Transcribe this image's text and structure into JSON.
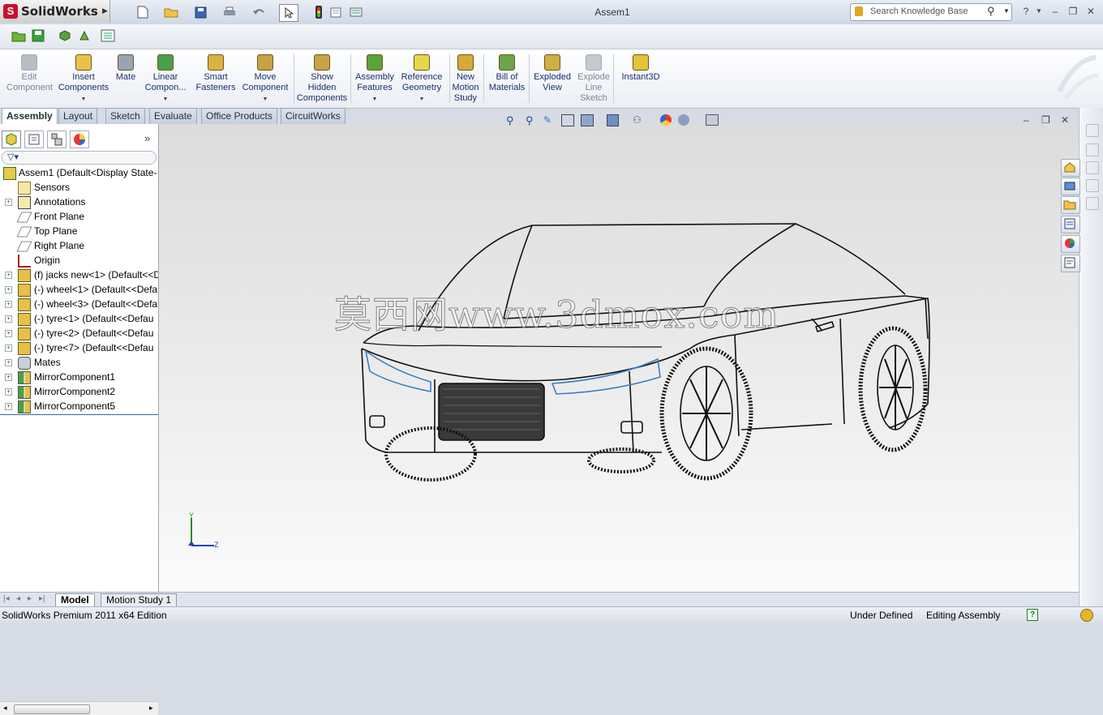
{
  "app": {
    "logo_text": "SolidWorks",
    "document_title": "Assem1"
  },
  "search": {
    "placeholder": "Search Knowledge Base"
  },
  "command_manager": [
    {
      "label_lines": [
        "Edit",
        "Component"
      ],
      "disabled": true,
      "icon": "edit-component-icon",
      "dropdown": false
    },
    {
      "label_lines": [
        "Insert",
        "Components"
      ],
      "disabled": false,
      "icon": "insert-components-icon",
      "dropdown": true
    },
    {
      "label_lines": [
        "Mate"
      ],
      "disabled": false,
      "icon": "mate-icon",
      "dropdown": false
    },
    {
      "label_lines": [
        "Linear",
        "Compon..."
      ],
      "disabled": false,
      "icon": "linear-pattern-icon",
      "dropdown": true
    },
    {
      "label_lines": [
        "Smart",
        "Fasteners"
      ],
      "disabled": false,
      "icon": "smart-fasteners-icon",
      "dropdown": false
    },
    {
      "label_lines": [
        "Move",
        "Component"
      ],
      "disabled": false,
      "icon": "move-component-icon",
      "dropdown": true
    },
    {
      "label_lines": [
        "Show",
        "Hidden",
        "Components"
      ],
      "disabled": false,
      "icon": "show-hidden-icon",
      "dropdown": false
    },
    {
      "label_lines": [
        "Assembly",
        "Features"
      ],
      "disabled": false,
      "icon": "assembly-features-icon",
      "dropdown": true
    },
    {
      "label_lines": [
        "Reference",
        "Geometry"
      ],
      "disabled": false,
      "icon": "reference-geometry-icon",
      "dropdown": true
    },
    {
      "label_lines": [
        "New",
        "Motion",
        "Study"
      ],
      "disabled": false,
      "icon": "motion-study-icon",
      "dropdown": false
    },
    {
      "label_lines": [
        "Bill of",
        "Materials"
      ],
      "disabled": false,
      "icon": "bill-of-materials-icon",
      "dropdown": false
    },
    {
      "label_lines": [
        "Exploded",
        "View"
      ],
      "disabled": false,
      "icon": "exploded-view-icon",
      "dropdown": false
    },
    {
      "label_lines": [
        "Explode",
        "Line",
        "Sketch"
      ],
      "disabled": true,
      "icon": "explode-line-icon",
      "dropdown": false
    },
    {
      "label_lines": [
        "Instant3D"
      ],
      "disabled": false,
      "icon": "instant3d-icon",
      "dropdown": false
    }
  ],
  "tabs": [
    "Assembly",
    "Layout",
    "Sketch",
    "Evaluate",
    "Office Products",
    "CircuitWorks"
  ],
  "active_tab": "Assembly",
  "feature_tree": [
    {
      "label": "Assem1  (Default<Display State-",
      "icon": "assembly-icon",
      "expander": false,
      "root": true
    },
    {
      "label": "Sensors",
      "icon": "sensors-icon",
      "expander": false
    },
    {
      "label": "Annotations",
      "icon": "annotations-icon",
      "expander": true
    },
    {
      "label": "Front Plane",
      "icon": "plane-icon",
      "expander": false
    },
    {
      "label": "Top Plane",
      "icon": "plane-icon",
      "expander": false
    },
    {
      "label": "Right Plane",
      "icon": "plane-icon",
      "expander": false
    },
    {
      "label": "Origin",
      "icon": "origin-icon",
      "expander": false
    },
    {
      "label": "(f) jacks new<1> (Default<<D",
      "icon": "part-icon",
      "expander": true
    },
    {
      "label": "(-) wheel<1> (Default<<Defa",
      "icon": "part-icon",
      "expander": true
    },
    {
      "label": "(-) wheel<3> (Default<<Defa",
      "icon": "part-icon",
      "expander": true
    },
    {
      "label": "(-) tyre<1> (Default<<Defau",
      "icon": "part-icon",
      "expander": true
    },
    {
      "label": "(-) tyre<2> (Default<<Defau",
      "icon": "part-icon",
      "expander": true
    },
    {
      "label": "(-) tyre<7> (Default<<Defau",
      "icon": "part-icon",
      "expander": true
    },
    {
      "label": "Mates",
      "icon": "mates-icon",
      "expander": true
    },
    {
      "label": "MirrorComponent1",
      "icon": "mirror-component-icon",
      "expander": true
    },
    {
      "label": "MirrorComponent2",
      "icon": "mirror-component-icon",
      "expander": true
    },
    {
      "label": "MirrorComponent5",
      "icon": "mirror-component-icon",
      "expander": true
    }
  ],
  "watermark": "莫西网www.3dmox.com",
  "triad": {
    "y_label": "Y",
    "z_label": "Z"
  },
  "bottom_tabs": [
    "Model",
    "Motion Study 1"
  ],
  "status": {
    "edition": "SolidWorks Premium 2011 x64 Edition",
    "state": "Under Defined",
    "mode": "Editing Assembly"
  },
  "colors": {
    "accent": "#1a2f6b",
    "headlight": "#3a7ec0",
    "brand_red": "#c8102e"
  }
}
